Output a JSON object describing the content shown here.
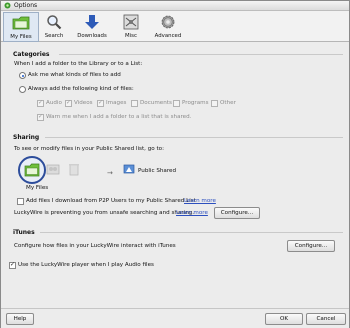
{
  "window": {
    "title": "Options"
  },
  "toolbar": {
    "items": [
      {
        "label": "My Files",
        "icon": "folder-icon",
        "active": true
      },
      {
        "label": "Search",
        "icon": "search-icon"
      },
      {
        "label": "Downloads",
        "icon": "downloads-arrow-icon"
      },
      {
        "label": "Misc",
        "icon": "misc-icon"
      },
      {
        "label": "Advanced",
        "icon": "gear-icon"
      }
    ]
  },
  "categories": {
    "title": "Categories",
    "prompt": "When I add a folder to the Library or to a List:",
    "option_ask": "Ask me what kinds of files to add",
    "option_always": "Always add the following kind of files:",
    "types": [
      {
        "label": "Audio",
        "checked": true
      },
      {
        "label": "Videos",
        "checked": true
      },
      {
        "label": "Images",
        "checked": true
      },
      {
        "label": "Documents",
        "checked": false
      },
      {
        "label": "Programs",
        "checked": false
      },
      {
        "label": "Other",
        "checked": false
      }
    ],
    "warn": "Warn me when I add a folder to a list that is shared."
  },
  "sharing": {
    "title": "Sharing",
    "prompt": "To see or modify files in your Public Shared list, go to:",
    "my_files_label": "My Files",
    "public_shared_label": "Public Shared",
    "p2p_text": "Add files I download from P2P Users to my Public Shared List",
    "learn_more_1": "Learn more",
    "unsafe_text": "LuckyWire is preventing you from unsafe searching and sharing.",
    "learn_more_2": "Learn more",
    "configure_label": "Configure..."
  },
  "itunes": {
    "title": "iTunes",
    "text": "Configure how files in your LuckyWire interact with iTunes",
    "configure_label": "Configure...",
    "player_text": "Use the LuckyWire player when I play Audio files"
  },
  "footer": {
    "help": "Help",
    "ok": "OK",
    "cancel": "Cancel"
  }
}
